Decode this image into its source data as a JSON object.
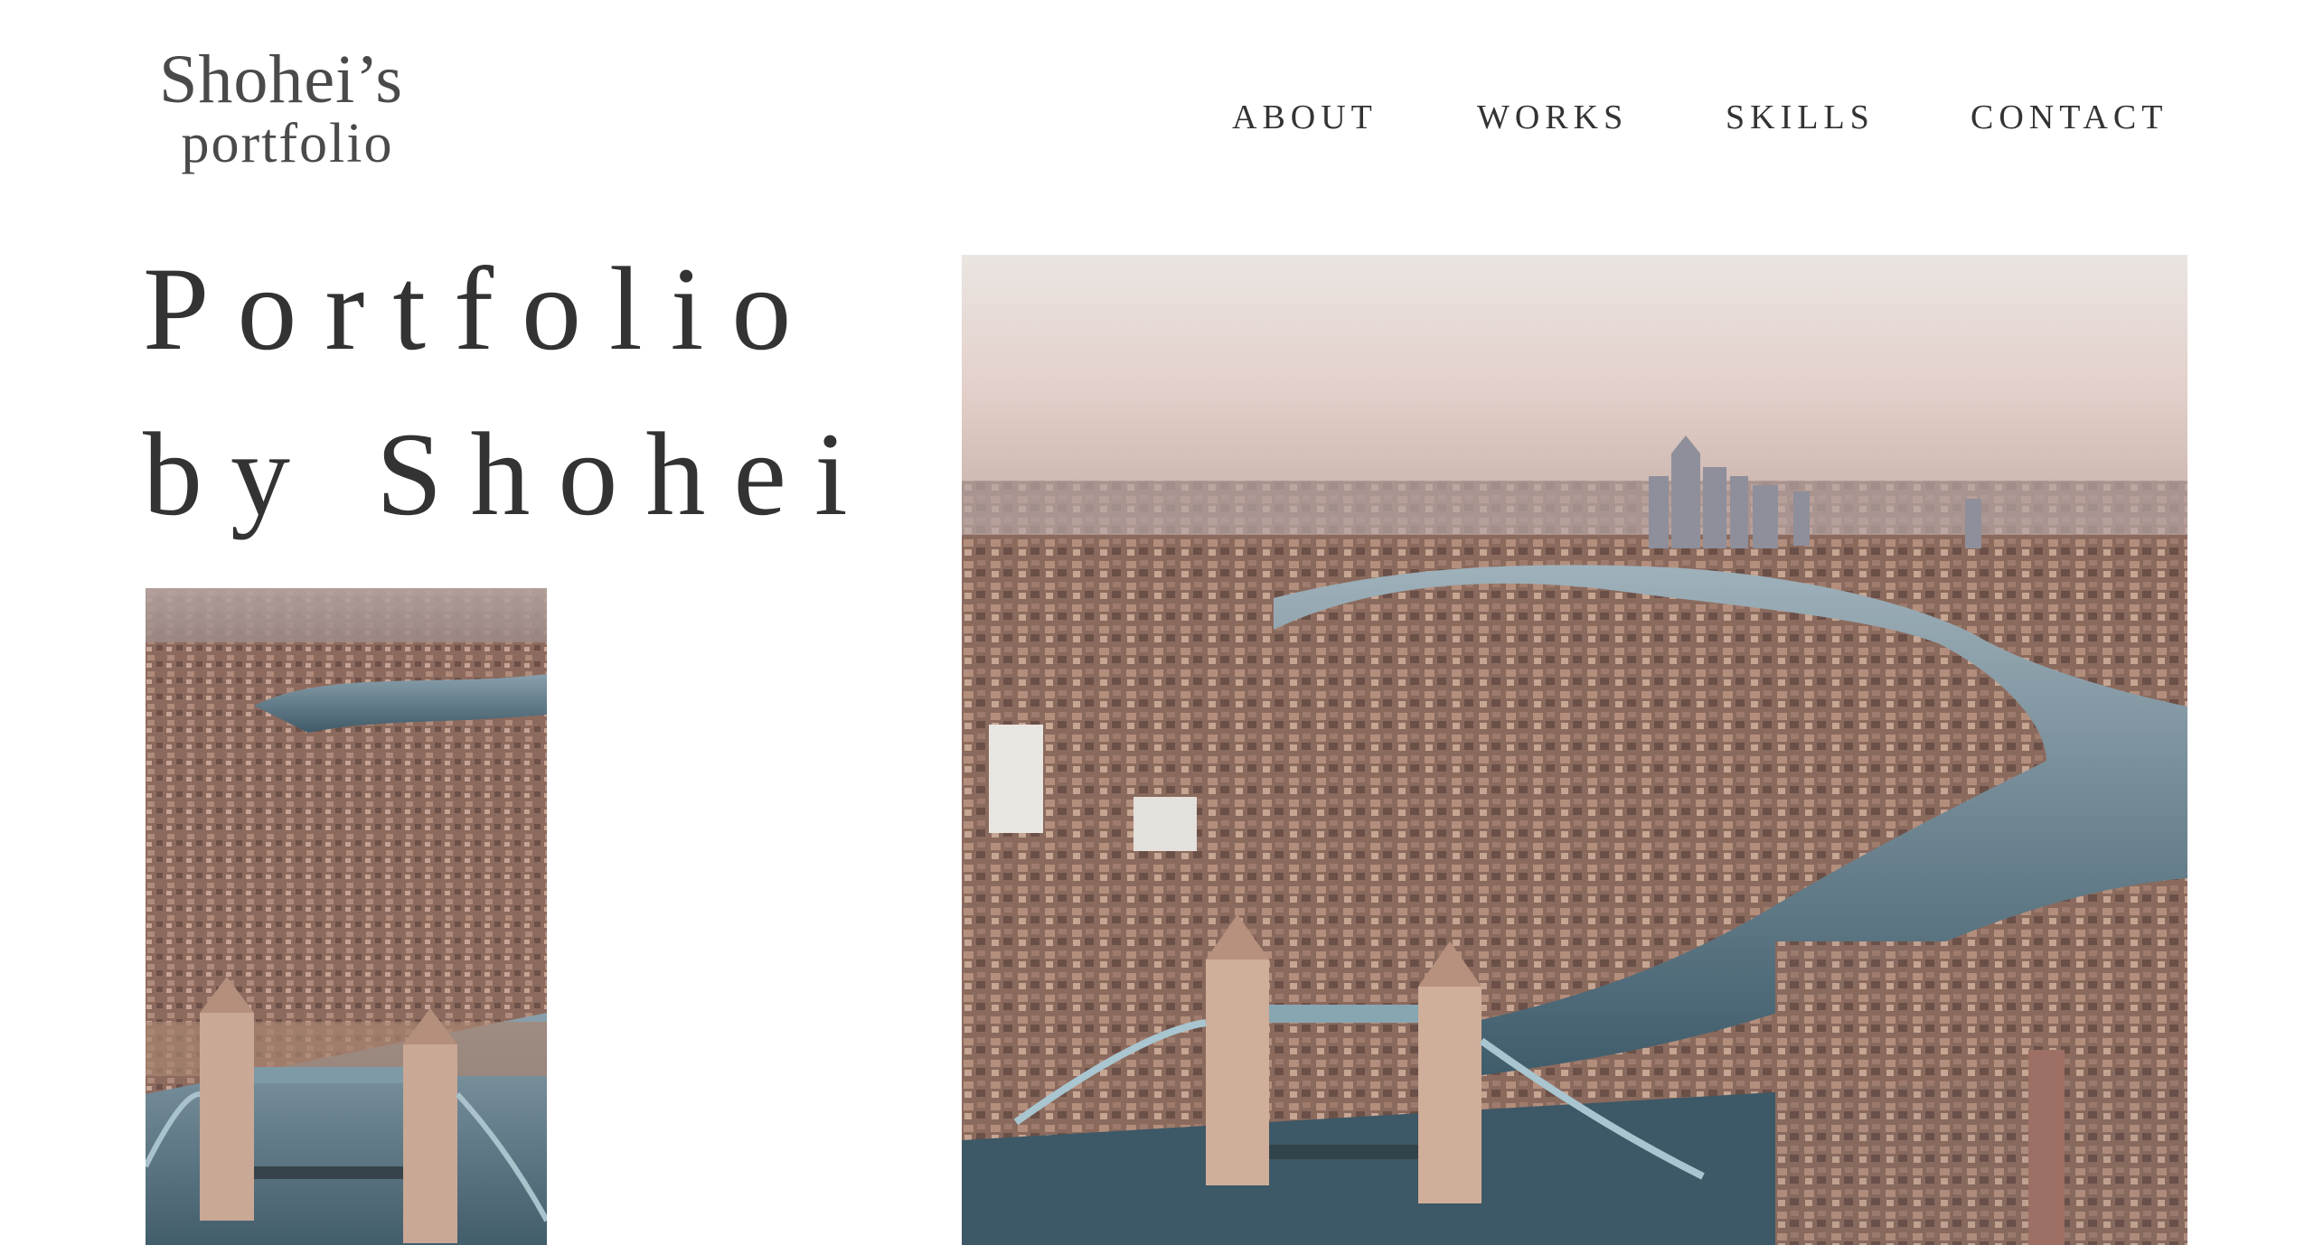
{
  "header": {
    "logo": {
      "line1": "Shohei’s",
      "line2": "portfolio"
    },
    "nav": [
      {
        "label": "ABOUT"
      },
      {
        "label": "WORKS"
      },
      {
        "label": "SKILLS"
      },
      {
        "label": "CONTACT"
      }
    ]
  },
  "hero": {
    "title_line1": "Portfolio",
    "title_line2": "by Shohei"
  },
  "images": {
    "small": "aerial photo of London city and Tower Bridge (cropped)",
    "large": "aerial photo of London, River Thames, Tower Bridge and Canary Wharf skyline"
  },
  "colors": {
    "text": "#333333",
    "background": "#ffffff",
    "sky": "#e8d9d4",
    "river": "#4e6b7a",
    "buildings": "#9c7466"
  }
}
